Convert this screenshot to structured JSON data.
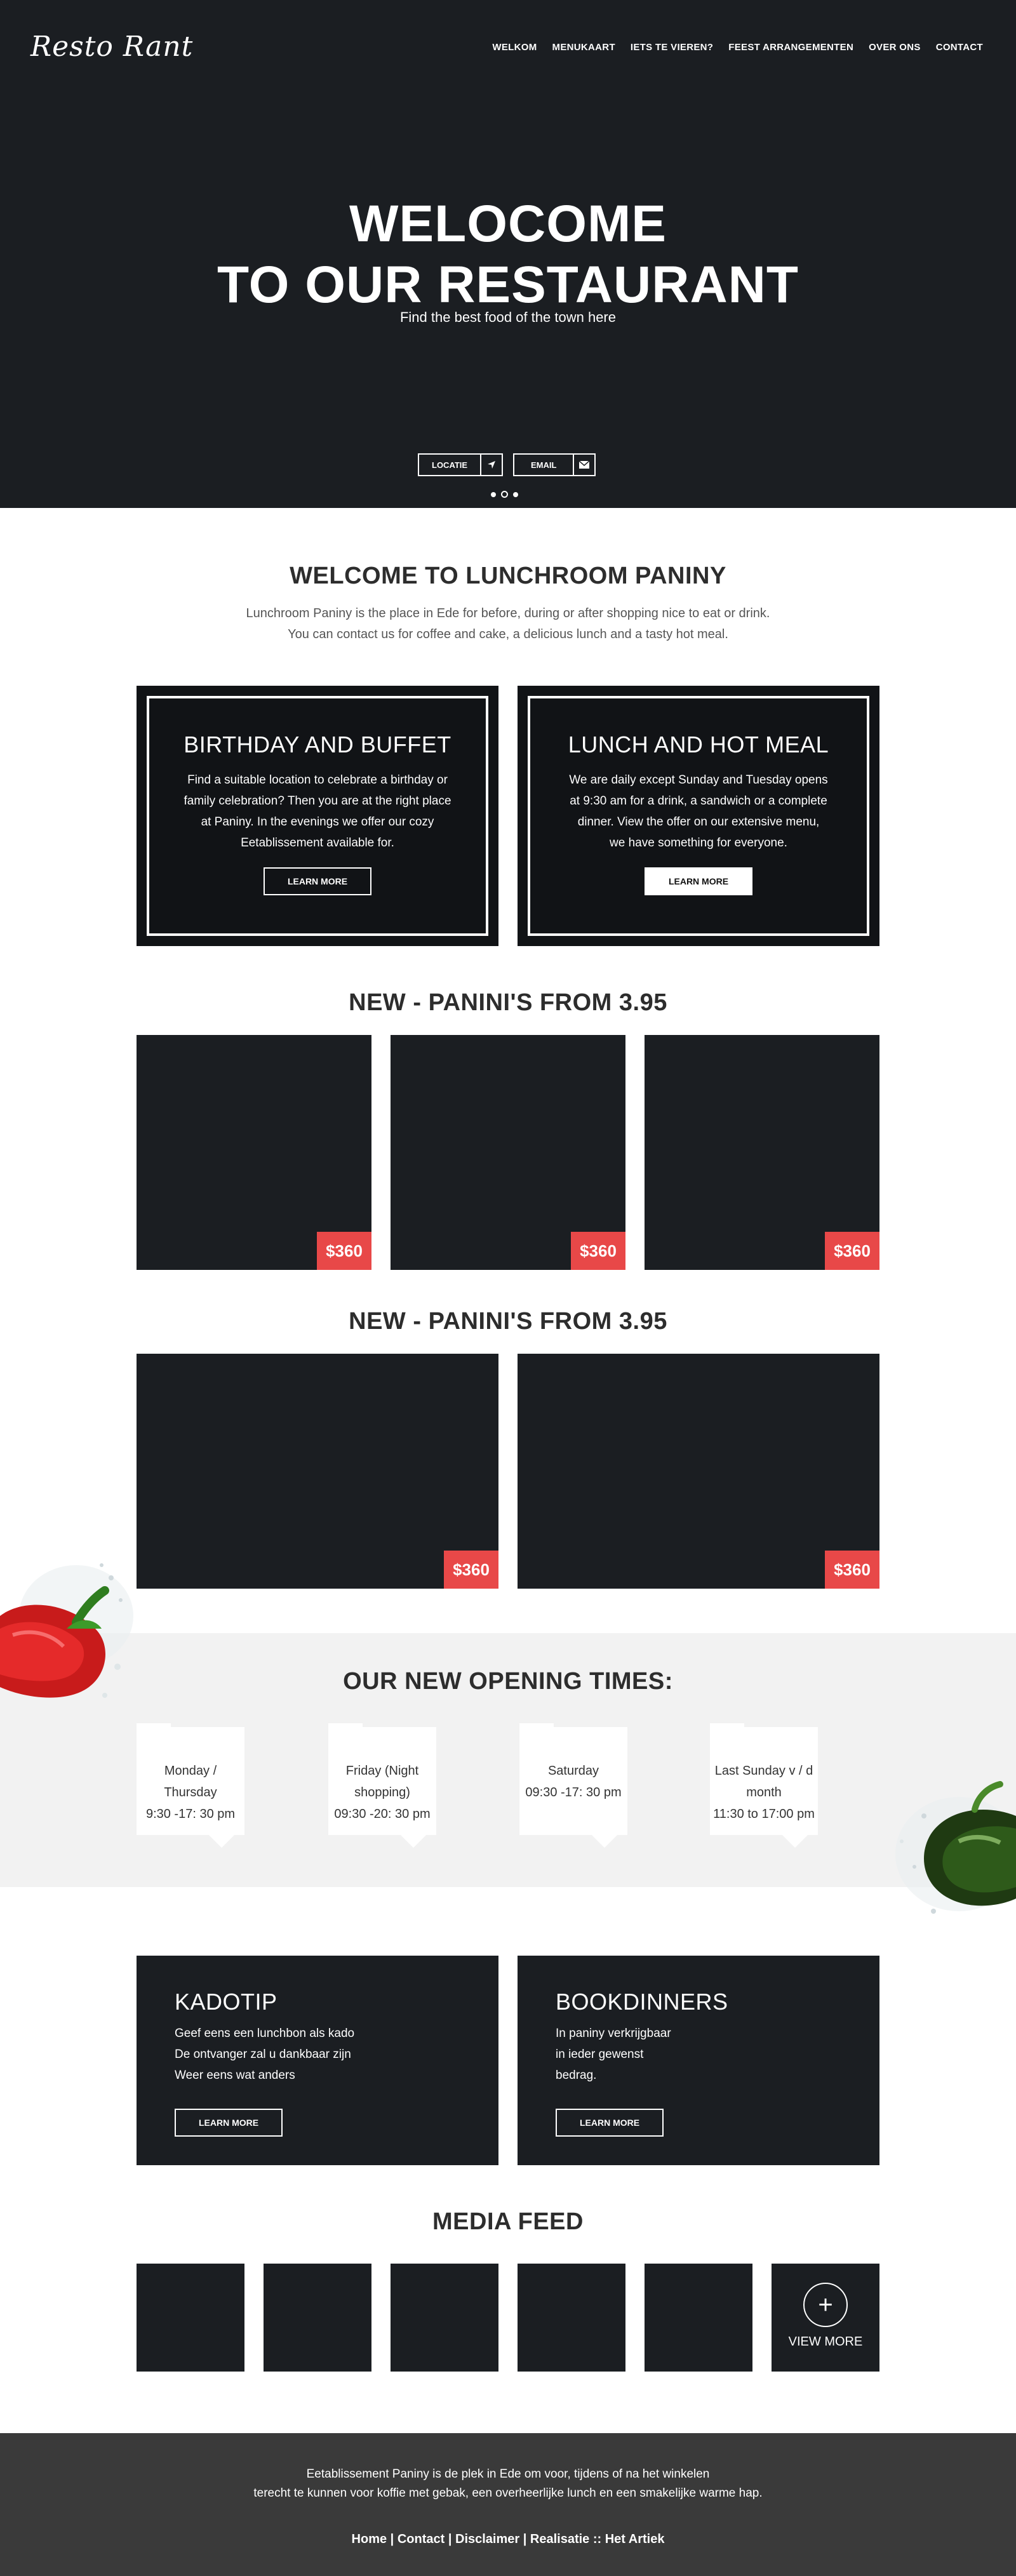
{
  "header": {
    "logo": "Resto Rant",
    "nav": [
      "WELKOM",
      "MENUKAART",
      "IETS TE VIEREN?",
      "FEEST ARRANGEMENTEN",
      "OVER ONS",
      "CONTACT"
    ]
  },
  "hero": {
    "title_line1": "WELOCOME",
    "title_line2": "TO OUR RESTAURANT",
    "subtitle": "Find the best food of the town here",
    "location_label": "LOCATIE",
    "email_label": "EMAIL",
    "slides": 3,
    "active_slide": 2
  },
  "welcome": {
    "title": "WELCOME TO LUNCHROOM PANINY",
    "line1": "Lunchroom Paniny is the place in Ede for before, during or after shopping nice to eat or drink.",
    "line2": "You can contact us for coffee and cake, a delicious lunch and a tasty hot meal."
  },
  "promos": [
    {
      "title": "BIRTHDAY AND BUFFET",
      "lines": [
        "Find a suitable location to celebrate a birthday or",
        "family celebration? Then you are at the right place",
        "at Paniny. In the evenings we offer our cozy",
        "Eetablissement available for."
      ],
      "button": "LEARN MORE"
    },
    {
      "title": "LUNCH AND HOT MEAL",
      "lines": [
        "We are daily except Sunday and Tuesday opens",
        "at 9:30 am for a drink, a sandwich or a complete",
        "dinner. View the offer on our extensive menu,",
        "we have something for everyone."
      ],
      "button": "LEARN MORE"
    }
  ],
  "paninis": {
    "title1": "NEW - PANINI'S FROM 3.95",
    "title2": "NEW - PANINI'S FROM 3.95",
    "prices": [
      "$360",
      "$360",
      "$360",
      "$360",
      "$360"
    ]
  },
  "opening": {
    "title": "OUR NEW OPENING TIMES:",
    "times": [
      {
        "day": "Monday / Thursday",
        "hours": "9:30 -17: 30 pm"
      },
      {
        "day": "Friday (Night shopping)",
        "hours": "09:30 -20: 30 pm"
      },
      {
        "day": "Saturday",
        "hours": "09:30 -17: 30 pm"
      },
      {
        "day": "Last Sunday v / d month",
        "hours": "11:30 to 17:00 pm"
      }
    ]
  },
  "info": [
    {
      "title": "KADOTIP",
      "lines": [
        "Geef eens een lunchbon als kado",
        "De ontvanger zal u dankbaar zijn",
        "Weer eens wat anders"
      ],
      "button": "LEARN MORE"
    },
    {
      "title": "BOOKDINNERS",
      "lines": [
        "In paniny verkrijgbaar",
        "in ieder gewenst",
        "bedrag."
      ],
      "button": "LEARN MORE"
    }
  ],
  "media": {
    "title": "MEDIA FEED",
    "view_more": "VIEW MORE"
  },
  "footer": {
    "line1": "Eetablissement Paniny is de plek in Ede om voor, tijdens of na het winkelen",
    "line2": "terecht te kunnen voor koffie met gebak, een overheerlijke lunch en een smakelijke warme hap.",
    "links": [
      "Home",
      "Contact",
      "Disclaimer",
      "Realisatie :: Het Artiek"
    ],
    "separator": " | "
  },
  "colors": {
    "dark": "#1b1e22",
    "accent": "#e84848",
    "band": "#f2f2f2",
    "footer": "#3a3a3a"
  }
}
